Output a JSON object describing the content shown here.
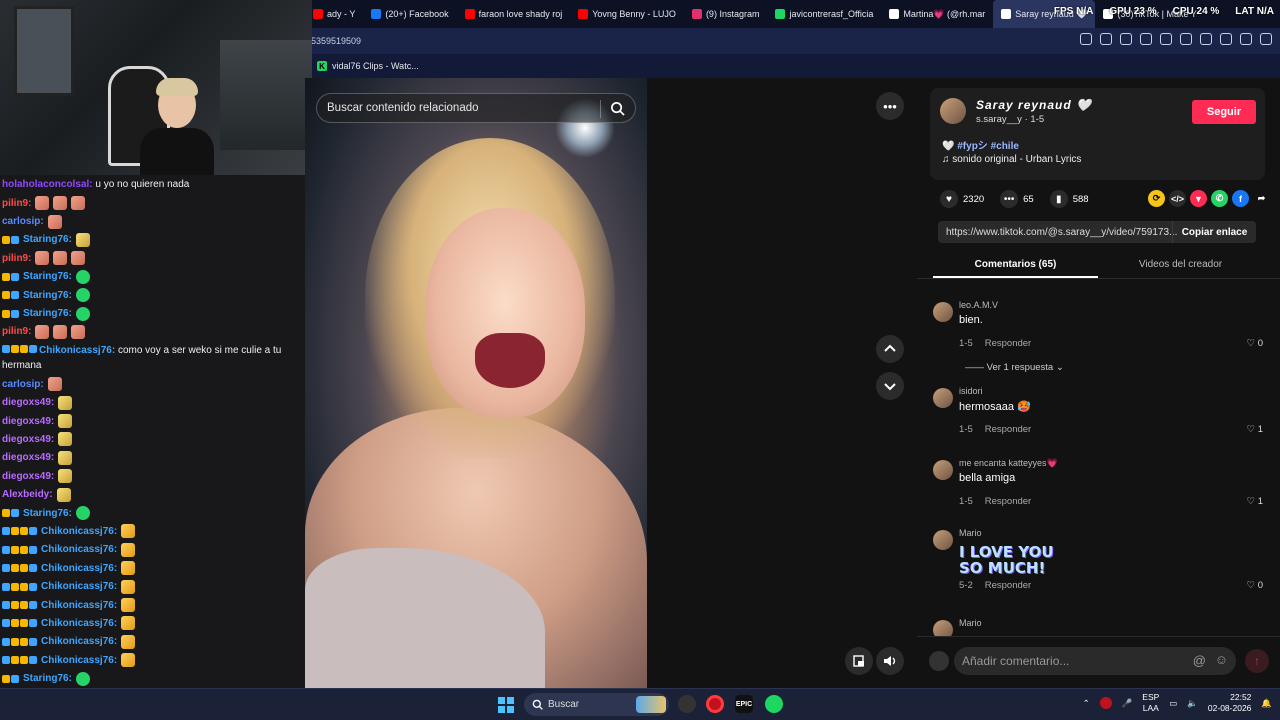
{
  "browser": {
    "tabs": [
      {
        "label": "ady - Y",
        "color": "#ff0000"
      },
      {
        "label": "(20+) Facebook",
        "color": "#1877f2"
      },
      {
        "label": "faraon love shady roj",
        "color": "#ff0000"
      },
      {
        "label": "Yovng Benny - LUJO",
        "color": "#ff0000"
      },
      {
        "label": "(9) Instagram",
        "color": "#e1306c"
      },
      {
        "label": "javicontrerasf_Officia",
        "color": "#1ed760"
      },
      {
        "label": "Martina💗 (@rh.mar",
        "color": "#ffffff"
      },
      {
        "label": "Saray reynaud 🤍",
        "color": "#ffffff"
      },
      {
        "label": "(30)TikTok | Make Y",
        "color": "#ffffff"
      }
    ],
    "url_fragment": "5359519509",
    "bookmark": "vidal76 Clips - Watc...",
    "perf": {
      "fps": "FPS N/A",
      "gpu": "GPU 23 %",
      "cpu": "CPU 24 %",
      "lat": "LAT N/A"
    }
  },
  "chat": {
    "messages": [
      {
        "user": "holaholaconcolsal:",
        "text": "u yo no quieren nada",
        "color": "#9147ff",
        "emotes": [],
        "badges": [],
        "wrap": true
      },
      {
        "user": "pilin9:",
        "text": "",
        "color": "#ff4a4a",
        "emotes": [
          "hand",
          "hand",
          "hand"
        ],
        "badges": []
      },
      {
        "user": "carlosip:",
        "text": "",
        "color": "#5b8cff",
        "emotes": [
          "hand"
        ],
        "badges": []
      },
      {
        "user": "Staring76:",
        "text": "",
        "color": "#3ea6ff",
        "emotes": [
          "wing"
        ],
        "badges": [
          "crown",
          "sub"
        ]
      },
      {
        "user": "pilin9:",
        "text": "",
        "color": "#ff4a4a",
        "emotes": [
          "hand",
          "hand",
          "hand"
        ],
        "badges": []
      },
      {
        "user": "Staring76:",
        "text": "",
        "color": "#3ea6ff",
        "emotes": [
          "wa"
        ],
        "badges": [
          "crown",
          "sub"
        ]
      },
      {
        "user": "Staring76:",
        "text": "",
        "color": "#3ea6ff",
        "emotes": [
          "wa"
        ],
        "badges": [
          "crown",
          "sub"
        ]
      },
      {
        "user": "Staring76:",
        "text": "",
        "color": "#3ea6ff",
        "emotes": [
          "wa"
        ],
        "badges": [
          "crown",
          "sub"
        ]
      },
      {
        "user": "pilin9:",
        "text": "",
        "color": "#ff4a4a",
        "emotes": [
          "hand",
          "hand",
          "hand"
        ],
        "badges": []
      },
      {
        "user": "Chikonicassj76:",
        "text": "como voy a ser weko si me culie a tu hermana",
        "color": "#3ea6ff",
        "emotes": [],
        "badges": [
          "sword",
          "crown",
          "info",
          "sub"
        ],
        "wrap": true
      },
      {
        "user": "carlosip:",
        "text": "",
        "color": "#5b8cff",
        "emotes": [
          "hand"
        ],
        "badges": []
      },
      {
        "user": "diegoxs49:",
        "text": "",
        "color": "#b96bff",
        "emotes": [
          "wing"
        ],
        "badges": []
      },
      {
        "user": "diegoxs49:",
        "text": "",
        "color": "#b96bff",
        "emotes": [
          "wing"
        ],
        "badges": []
      },
      {
        "user": "diegoxs49:",
        "text": "",
        "color": "#b96bff",
        "emotes": [
          "wing"
        ],
        "badges": []
      },
      {
        "user": "diegoxs49:",
        "text": "",
        "color": "#b96bff",
        "emotes": [
          "wing"
        ],
        "badges": []
      },
      {
        "user": "diegoxs49:",
        "text": "",
        "color": "#b96bff",
        "emotes": [
          "wing"
        ],
        "badges": []
      },
      {
        "user": "Alexbeidy:",
        "text": "",
        "color": "#b96bff",
        "emotes": [
          "wing"
        ],
        "badges": []
      },
      {
        "user": "Staring76:",
        "text": "",
        "color": "#3ea6ff",
        "emotes": [
          "wa"
        ],
        "badges": [
          "crown",
          "sub"
        ]
      },
      {
        "user": "Chikonicassj76:",
        "text": "",
        "color": "#3ea6ff",
        "emotes": [
          "ok"
        ],
        "badges": [
          "sword",
          "crown",
          "info",
          "sub"
        ]
      },
      {
        "user": "Chikonicassj76:",
        "text": "",
        "color": "#3ea6ff",
        "emotes": [
          "ok"
        ],
        "badges": [
          "sword",
          "crown",
          "info",
          "sub"
        ]
      },
      {
        "user": "Chikonicassj76:",
        "text": "",
        "color": "#3ea6ff",
        "emotes": [
          "ok"
        ],
        "badges": [
          "sword",
          "crown",
          "info",
          "sub"
        ]
      },
      {
        "user": "Chikonicassj76:",
        "text": "",
        "color": "#3ea6ff",
        "emotes": [
          "ok"
        ],
        "badges": [
          "sword",
          "crown",
          "info",
          "sub"
        ]
      },
      {
        "user": "Chikonicassj76:",
        "text": "",
        "color": "#3ea6ff",
        "emotes": [
          "ok"
        ],
        "badges": [
          "sword",
          "crown",
          "info",
          "sub"
        ]
      },
      {
        "user": "Chikonicassj76:",
        "text": "",
        "color": "#3ea6ff",
        "emotes": [
          "ok"
        ],
        "badges": [
          "sword",
          "crown",
          "info",
          "sub"
        ]
      },
      {
        "user": "Chikonicassj76:",
        "text": "",
        "color": "#3ea6ff",
        "emotes": [
          "ok"
        ],
        "badges": [
          "sword",
          "crown",
          "info",
          "sub"
        ]
      },
      {
        "user": "Chikonicassj76:",
        "text": "",
        "color": "#3ea6ff",
        "emotes": [
          "ok"
        ],
        "badges": [
          "sword",
          "crown",
          "info",
          "sub"
        ]
      },
      {
        "user": "Staring76:",
        "text": "",
        "color": "#3ea6ff",
        "emotes": [
          "wa"
        ],
        "badges": [
          "crown",
          "sub"
        ]
      },
      {
        "user": "Staring76:",
        "text": "",
        "color": "#3ea6ff",
        "emotes": [
          "wa"
        ],
        "badges": [
          "crown",
          "sub"
        ]
      }
    ]
  },
  "video": {
    "search_placeholder": "Buscar contenido relacionado"
  },
  "creator": {
    "name": "Saray reynaud 🤍",
    "handle": "s.saray__y · 1-5",
    "follow_label": "Seguir",
    "desc_heart": "🤍",
    "desc_tags": "#fypシ #chile",
    "music": "sonido original - Urban Lyrics"
  },
  "stats": {
    "likes": "2320",
    "comments": "65",
    "saves": "588"
  },
  "share": {
    "url": "https://www.tiktok.com/@s.saray__y/video/759173...",
    "copy_label": "Copiar enlace"
  },
  "tabs": {
    "comments": "Comentarios (65)",
    "creator_videos": "Videos del creador"
  },
  "comments": [
    {
      "user": "leo.A.M.V",
      "text": "bien.",
      "date": "1-5",
      "reply": "Responder",
      "likes": "0",
      "replies": "Ver 1 respuesta",
      "sticker": ""
    },
    {
      "user": "isidori",
      "text": "hermosaaa 🥵",
      "date": "1-5",
      "reply": "Responder",
      "likes": "1",
      "replies": "",
      "sticker": ""
    },
    {
      "user": "me encanta katteyyes💗",
      "text": "bella amiga",
      "date": "1-5",
      "reply": "Responder",
      "likes": "1",
      "replies": "",
      "sticker": ""
    },
    {
      "user": "Mario",
      "text": "",
      "date": "5-2",
      "reply": "Responder",
      "likes": "0",
      "replies": "",
      "sticker": "I LOVE YOU\nSO MUCH!"
    },
    {
      "user": "Mario",
      "text": "",
      "date": "",
      "reply": "",
      "likes": "",
      "replies": "",
      "sticker": ""
    }
  ],
  "compose": {
    "placeholder": "Añadir comentario..."
  },
  "taskbar": {
    "search": "Buscar",
    "lang1": "ESP",
    "lang2": "LAA",
    "time": "22:52",
    "date": "02-08-2026"
  },
  "colors": {
    "accent": "#fe2c55",
    "panel": "#121212",
    "chrome": "#0c1224"
  }
}
